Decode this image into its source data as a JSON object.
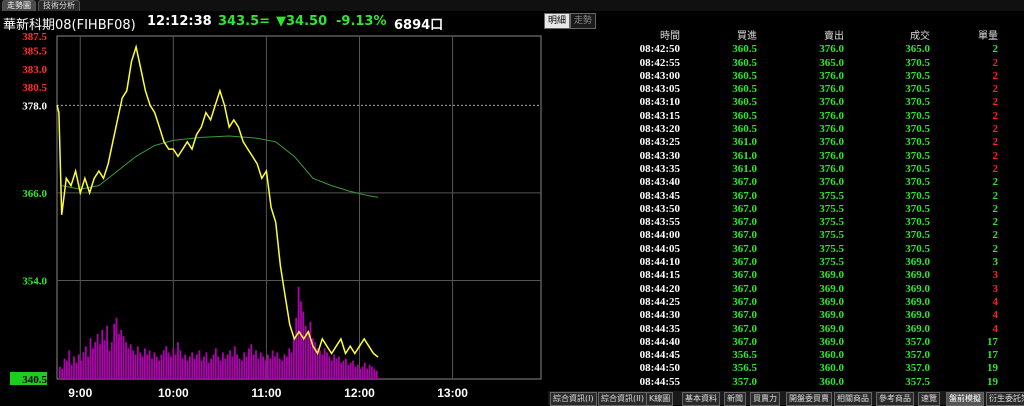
{
  "tabs": [
    "走勢圖",
    "技術分析"
  ],
  "header": {
    "symbol": "華新科期08(FIHBF08)",
    "time": "12:12:38",
    "price": "343.5=",
    "change": "▼34.50",
    "pct": "-9.13%",
    "volume": "6894口"
  },
  "buttons": {
    "detail": "明細",
    "trend": "走勢"
  },
  "colors": {
    "up": "#ff2020",
    "down": "#2ee62e",
    "price_line": "#ffff30",
    "avg_line": "#3c9a3c",
    "volume": "#b000b0",
    "grid": "#555555"
  },
  "chart_data": {
    "type": "line",
    "yticks": [
      {
        "v": 387.5,
        "label": "387.5",
        "color": "#ff3030"
      },
      {
        "v": 385.5,
        "label": "385.5",
        "color": "#ff3030"
      },
      {
        "v": 383.0,
        "label": "383.0",
        "color": "#ff3030"
      },
      {
        "v": 380.5,
        "label": "380.5",
        "color": "#ff3030"
      },
      {
        "v": 378.0,
        "label": "378.0",
        "color": "#ffffff"
      },
      {
        "v": 366.0,
        "label": "366.0",
        "color": "#2ee62e"
      },
      {
        "v": 354.0,
        "label": "354.0",
        "color": "#2ee62e"
      },
      {
        "v": 340.5,
        "label": "340.5",
        "color": "#000000"
      }
    ],
    "xticks": [
      "9:00",
      "10:00",
      "11:00",
      "12:00",
      "13:00"
    ],
    "ylim": [
      340.5,
      387.5
    ],
    "ref_price": 378.0,
    "last_price": 343.5,
    "price": [
      [
        8.75,
        378
      ],
      [
        8.77,
        377
      ],
      [
        8.8,
        363
      ],
      [
        8.85,
        368
      ],
      [
        8.9,
        367
      ],
      [
        8.95,
        369
      ],
      [
        9.0,
        366
      ],
      [
        9.05,
        368
      ],
      [
        9.1,
        366
      ],
      [
        9.15,
        368
      ],
      [
        9.2,
        369
      ],
      [
        9.25,
        368
      ],
      [
        9.3,
        370
      ],
      [
        9.35,
        373
      ],
      [
        9.4,
        376
      ],
      [
        9.45,
        379
      ],
      [
        9.5,
        380
      ],
      [
        9.55,
        384
      ],
      [
        9.6,
        386
      ],
      [
        9.65,
        383
      ],
      [
        9.7,
        380
      ],
      [
        9.75,
        378
      ],
      [
        9.8,
        377
      ],
      [
        9.85,
        375
      ],
      [
        9.9,
        373
      ],
      [
        9.95,
        372
      ],
      [
        10.0,
        372
      ],
      [
        10.05,
        371
      ],
      [
        10.1,
        372
      ],
      [
        10.15,
        373
      ],
      [
        10.2,
        372
      ],
      [
        10.25,
        374
      ],
      [
        10.3,
        375
      ],
      [
        10.35,
        377
      ],
      [
        10.4,
        376
      ],
      [
        10.45,
        378
      ],
      [
        10.5,
        380
      ],
      [
        10.55,
        378
      ],
      [
        10.6,
        375
      ],
      [
        10.65,
        376
      ],
      [
        10.7,
        375
      ],
      [
        10.75,
        373
      ],
      [
        10.8,
        372
      ],
      [
        10.85,
        371
      ],
      [
        10.9,
        370
      ],
      [
        10.95,
        368
      ],
      [
        11.0,
        369
      ],
      [
        11.05,
        364
      ],
      [
        11.1,
        362
      ],
      [
        11.15,
        356
      ],
      [
        11.2,
        352
      ],
      [
        11.25,
        348
      ],
      [
        11.3,
        346
      ],
      [
        11.35,
        347
      ],
      [
        11.4,
        346
      ],
      [
        11.45,
        347
      ],
      [
        11.5,
        345
      ],
      [
        11.55,
        344
      ],
      [
        11.6,
        346
      ],
      [
        11.65,
        345
      ],
      [
        11.7,
        344
      ],
      [
        11.75,
        345
      ],
      [
        11.8,
        346
      ],
      [
        11.85,
        344
      ],
      [
        11.9,
        345
      ],
      [
        11.95,
        344
      ],
      [
        12.0,
        345
      ],
      [
        12.05,
        346
      ],
      [
        12.1,
        345
      ],
      [
        12.15,
        344
      ],
      [
        12.2,
        343.5
      ]
    ],
    "avg": [
      [
        8.8,
        367
      ],
      [
        9.0,
        366.5
      ],
      [
        9.2,
        367
      ],
      [
        9.4,
        369
      ],
      [
        9.6,
        371
      ],
      [
        9.8,
        372.5
      ],
      [
        10.0,
        373.2
      ],
      [
        10.3,
        373.6
      ],
      [
        10.6,
        373.8
      ],
      [
        10.9,
        373.5
      ],
      [
        11.1,
        373
      ],
      [
        11.3,
        371
      ],
      [
        11.5,
        368
      ],
      [
        11.7,
        367
      ],
      [
        11.9,
        366.2
      ],
      [
        12.1,
        365.6
      ],
      [
        12.2,
        365.4
      ]
    ],
    "volume": [
      6,
      5,
      10,
      9,
      14,
      7,
      11,
      8,
      12,
      9,
      13,
      16,
      11,
      20,
      15,
      18,
      22,
      17,
      24,
      19,
      26,
      14,
      18,
      27,
      30,
      22,
      24,
      21,
      18,
      15,
      17,
      14,
      12,
      16,
      13,
      11,
      15,
      12,
      14,
      10,
      13,
      11,
      9,
      12,
      14,
      16,
      13,
      11,
      15,
      12,
      18,
      14,
      10,
      12,
      9,
      11,
      13,
      10,
      12,
      14,
      9,
      11,
      13,
      8,
      10,
      12,
      15,
      11,
      9,
      13,
      10,
      12,
      14,
      11,
      16,
      12,
      10,
      9,
      13,
      11,
      15,
      17,
      12,
      14,
      10,
      13,
      11,
      9,
      12,
      10,
      14,
      11,
      13,
      10,
      9,
      12,
      11,
      15,
      13,
      20,
      30,
      45,
      38,
      33,
      26,
      22,
      28,
      20,
      18,
      15,
      14,
      12,
      15,
      13,
      11,
      9,
      12,
      10,
      11,
      8,
      9,
      10,
      7,
      8,
      9,
      6,
      7,
      5,
      6,
      8,
      5,
      7,
      6,
      5,
      4
    ]
  },
  "table": {
    "headers": [
      "時間",
      "買進",
      "賣出",
      "成交",
      "單量"
    ],
    "rows": [
      [
        "08:42:50",
        "360.5",
        "376.0",
        "365.0",
        "2",
        "g"
      ],
      [
        "08:42:55",
        "360.5",
        "365.0",
        "370.5",
        "2",
        "r"
      ],
      [
        "08:43:00",
        "360.5",
        "376.0",
        "370.5",
        "2",
        "r"
      ],
      [
        "08:43:05",
        "360.5",
        "376.0",
        "370.5",
        "2",
        "r"
      ],
      [
        "08:43:10",
        "360.5",
        "376.0",
        "370.5",
        "2",
        "r"
      ],
      [
        "08:43:15",
        "360.5",
        "376.0",
        "370.5",
        "2",
        "r"
      ],
      [
        "08:43:20",
        "360.5",
        "376.0",
        "370.5",
        "2",
        "r"
      ],
      [
        "08:43:25",
        "361.0",
        "376.0",
        "370.5",
        "2",
        "r"
      ],
      [
        "08:43:30",
        "361.0",
        "376.0",
        "370.5",
        "2",
        "r"
      ],
      [
        "08:43:35",
        "361.0",
        "376.0",
        "370.5",
        "2",
        "r"
      ],
      [
        "08:43:40",
        "367.0",
        "376.0",
        "370.5",
        "2",
        "g"
      ],
      [
        "08:43:45",
        "367.0",
        "375.5",
        "370.5",
        "2",
        "g"
      ],
      [
        "08:43:50",
        "367.0",
        "375.5",
        "370.5",
        "2",
        "g"
      ],
      [
        "08:43:55",
        "367.0",
        "375.5",
        "370.5",
        "2",
        "g"
      ],
      [
        "08:44:00",
        "367.0",
        "375.5",
        "370.5",
        "2",
        "g"
      ],
      [
        "08:44:05",
        "367.0",
        "375.5",
        "370.5",
        "2",
        "g"
      ],
      [
        "08:44:10",
        "367.0",
        "375.5",
        "369.0",
        "3",
        "g"
      ],
      [
        "08:44:15",
        "367.0",
        "369.0",
        "369.0",
        "3",
        "r"
      ],
      [
        "08:44:20",
        "367.0",
        "369.0",
        "369.0",
        "3",
        "r"
      ],
      [
        "08:44:25",
        "367.0",
        "369.0",
        "369.0",
        "4",
        "r"
      ],
      [
        "08:44:30",
        "367.0",
        "369.0",
        "369.0",
        "4",
        "r"
      ],
      [
        "08:44:35",
        "367.0",
        "369.0",
        "369.0",
        "4",
        "r"
      ],
      [
        "08:44:40",
        "367.0",
        "369.0",
        "357.0",
        "17",
        "g"
      ],
      [
        "08:44:45",
        "356.5",
        "360.0",
        "357.0",
        "17",
        "g"
      ],
      [
        "08:44:50",
        "356.5",
        "360.0",
        "357.0",
        "19",
        "g"
      ],
      [
        "08:44:55",
        "357.0",
        "360.0",
        "357.5",
        "19",
        "g"
      ]
    ]
  },
  "bottom_tabs": [
    "綜合資訊(I)",
    "綜合資訊(II)",
    "K線圖",
    "基本資料",
    "新聞",
    "買賣力",
    "開盤委買賣",
    "相關商品",
    "參考商品",
    "速覽",
    "盤前模擬",
    "衍生委託簿"
  ]
}
